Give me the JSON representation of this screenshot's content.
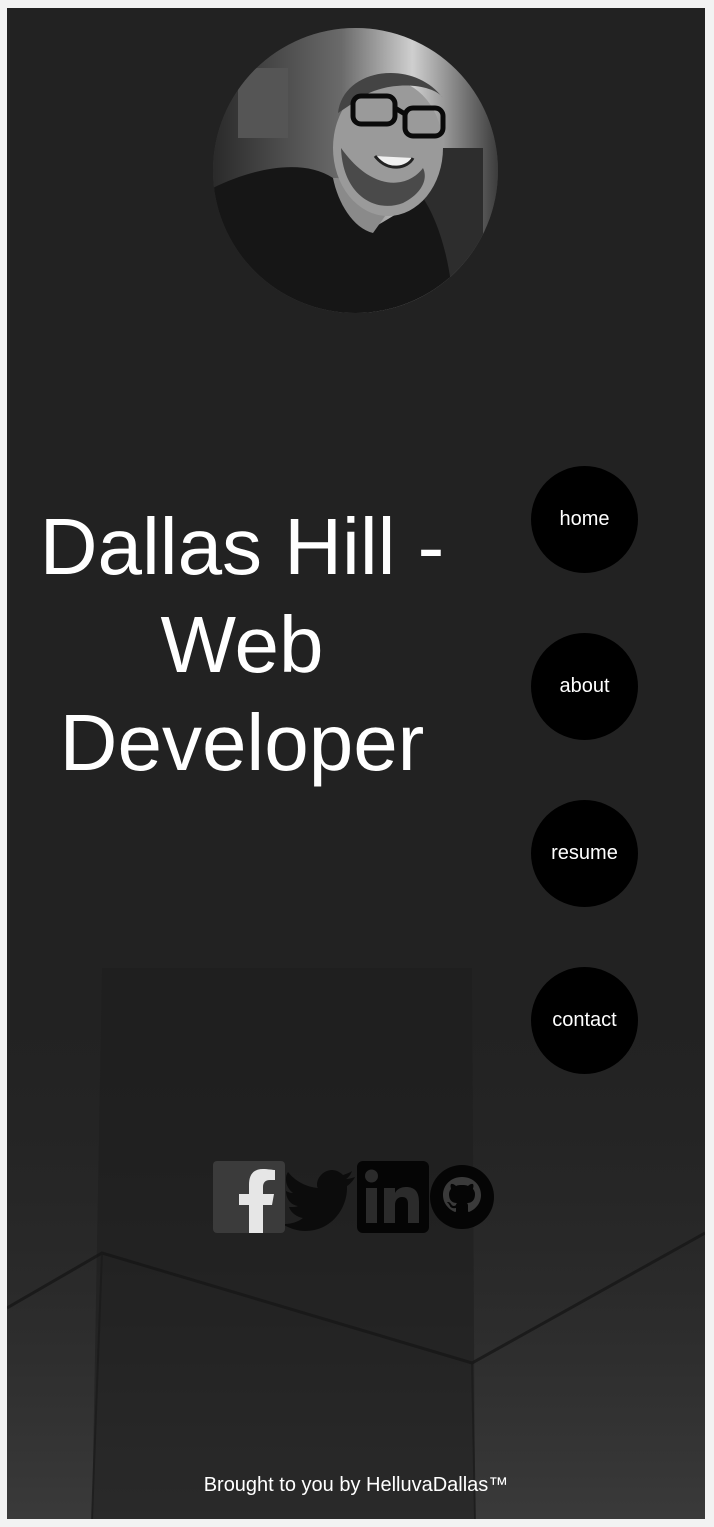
{
  "profile": {
    "photo_alt": "Dallas Hill"
  },
  "hero": {
    "title": "Dallas Hill - Web Developer"
  },
  "nav": {
    "items": [
      {
        "label": "home"
      },
      {
        "label": "about"
      },
      {
        "label": "resume"
      },
      {
        "label": "contact"
      }
    ]
  },
  "social": {
    "icons": [
      "facebook-icon",
      "twitter-icon",
      "linkedin-icon",
      "github-icon"
    ]
  },
  "footer": {
    "text": "Brought to you by HelluvaDallas™"
  },
  "colors": {
    "background": "#222222",
    "button": "#000000",
    "text": "#ffffff"
  }
}
